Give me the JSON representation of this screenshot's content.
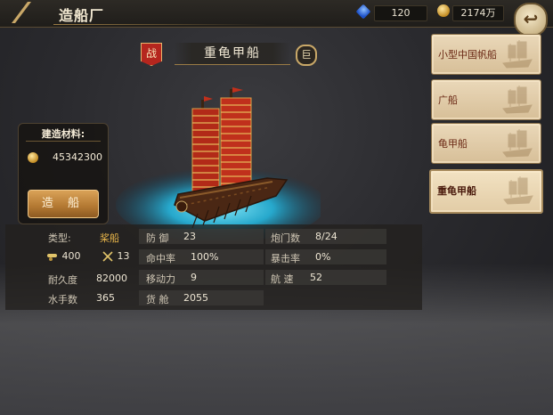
{
  "header": {
    "title": "造船厂",
    "gems": "120",
    "gold": "2174万"
  },
  "ship": {
    "war_badge": "战",
    "name": "重龟甲船",
    "size_badge": "巨"
  },
  "materials": {
    "title": "建造材料:",
    "gold_cost": "45342300",
    "build_button": "造 船"
  },
  "stats": {
    "type_label": "类型:",
    "type_value": "桨船",
    "cannon_value": "400",
    "sword_value": "13",
    "durability_label": "耐久度",
    "durability_value": "82000",
    "sailors_label": "水手数",
    "sailors_value": "365",
    "defense_label": "防 御",
    "defense_value": "23",
    "hit_label": "命中率",
    "hit_value": "100%",
    "move_label": "移动力",
    "move_value": "9",
    "cargo_label": "货 舱",
    "cargo_value": "2055",
    "gunports_label": "炮门数",
    "gunports_value": "8/24",
    "crit_label": "暴击率",
    "crit_value": "0%",
    "speed_label": "航 速",
    "speed_value": "52"
  },
  "ship_list": [
    {
      "label": "小型中国帆船",
      "selected": false
    },
    {
      "label": "广船",
      "selected": false
    },
    {
      "label": "龟甲船",
      "selected": false
    },
    {
      "label": "重龟甲船",
      "selected": true
    }
  ],
  "colors": {
    "accent_gold": "#c9a868",
    "sail_red": "#c0301c",
    "water_cyan": "#2fb8d6",
    "build_button": "#b37832"
  }
}
